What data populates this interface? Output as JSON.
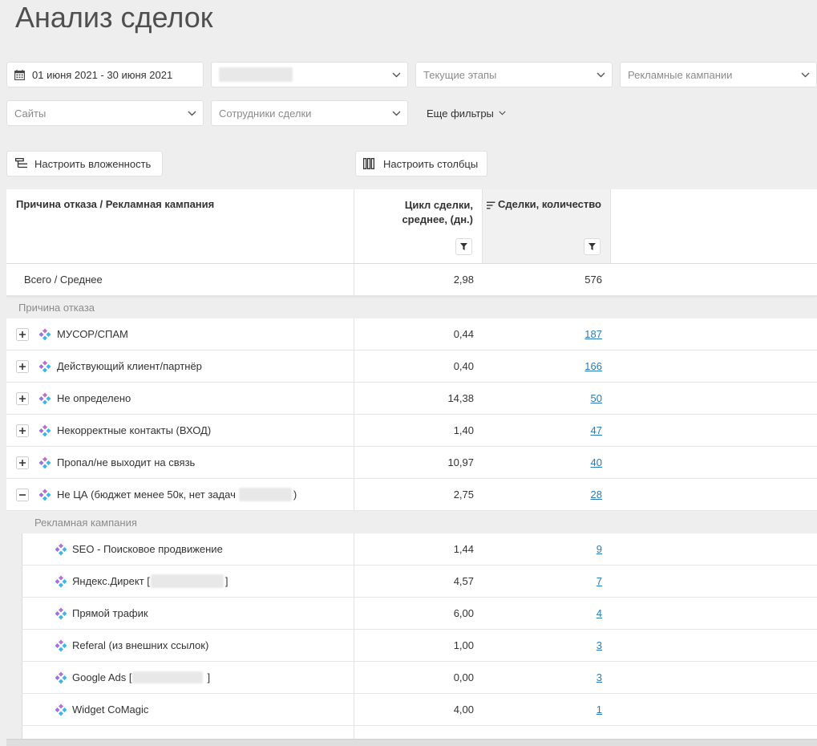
{
  "page": {
    "title": "Анализ сделок"
  },
  "filters": {
    "date_range": "01 июня 2021 - 30 июня 2021",
    "stages": "Текущие этапы",
    "campaigns": "Рекламные кампании",
    "sites": "Сайты",
    "employees": "Сотрудники сделки",
    "more": "Еще фильтры"
  },
  "toolbar": {
    "nesting": "Настроить вложенность",
    "columns": "Настроить столбцы"
  },
  "table": {
    "headers": {
      "dimension": "Причина отказа / Рекламная кампания",
      "cycle": "Цикл сделки, среднее, (дн.)",
      "deals": "Сделки, количество"
    },
    "total": {
      "label": "Всего / Среднее",
      "cycle": "2,98",
      "deals": "576"
    },
    "group_label": "Причина отказа",
    "rows": [
      {
        "label": "МУСОР/СПАМ",
        "cycle": "0,44",
        "deals": "187",
        "expanded": false
      },
      {
        "label": "Действующий клиент/партнёр",
        "cycle": "0,40",
        "deals": "166",
        "expanded": false
      },
      {
        "label": "Не определено",
        "cycle": "14,38",
        "deals": "50",
        "expanded": false
      },
      {
        "label": "Некорректные контакты (ВХОД)",
        "cycle": "1,40",
        "deals": "47",
        "expanded": false
      },
      {
        "label": "Пропал/не выходит на связь",
        "cycle": "10,97",
        "deals": "40",
        "expanded": false
      },
      {
        "label": "Не ЦА (бюджет менее 50к, нет задач",
        "label_end": ")",
        "cycle": "2,75",
        "deals": "28",
        "expanded": true
      }
    ],
    "subgroup_label": "Рекламная кампания",
    "subrows": [
      {
        "label": "SEO - Поисковое продвижение",
        "cycle": "1,44",
        "deals": "9"
      },
      {
        "label": "Яндекс.Директ [",
        "label_end": "]",
        "cycle": "4,57",
        "deals": "7"
      },
      {
        "label": "Прямой трафик",
        "cycle": "6,00",
        "deals": "4"
      },
      {
        "label": "Referal (из внешних ссылок)",
        "cycle": "1,00",
        "deals": "3"
      },
      {
        "label": "Google Ads [",
        "label_end": "]",
        "cycle": "0,00",
        "deals": "3"
      },
      {
        "label": "Widget CoMagic",
        "cycle": "4,00",
        "deals": "1"
      }
    ]
  },
  "icons": {
    "date": "calendar-icon",
    "dropdown": "chevron-down-icon",
    "nesting": "hierarchy-icon",
    "columns": "columns-icon",
    "filter": "funnel-icon",
    "sort": "sort-desc-icon",
    "expand": "plus-box-icon",
    "collapse": "minus-box-icon",
    "row": "campaign-diamond-icon"
  },
  "colors": {
    "page_bg": "#eeeeee",
    "link": "#2b7bbd",
    "text": "#333333",
    "muted": "#8a8a8a"
  }
}
